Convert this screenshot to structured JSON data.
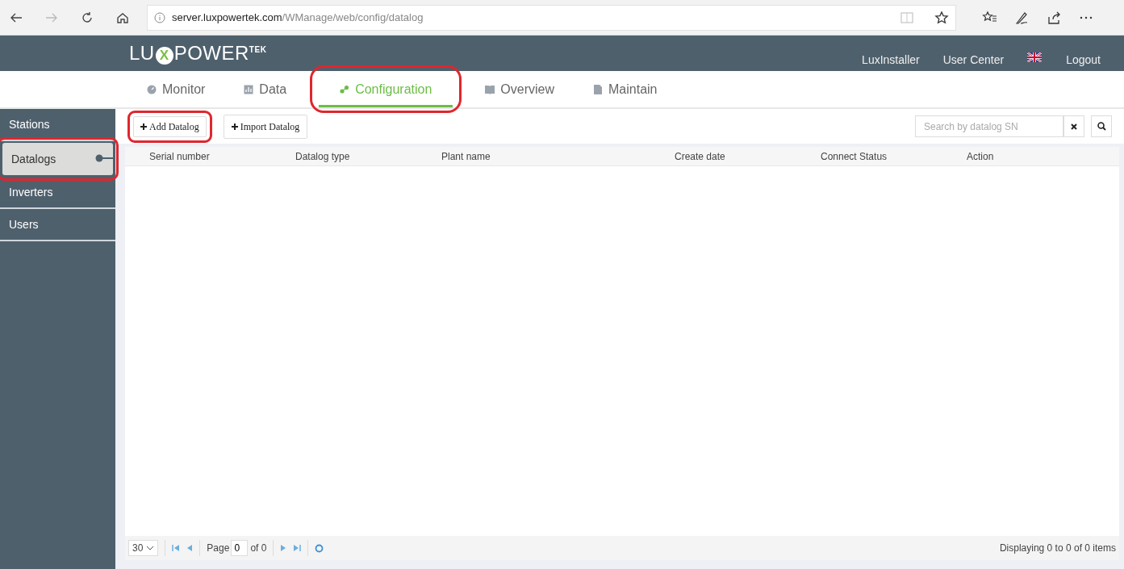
{
  "browser": {
    "url_host": "server.luxpowertek.com",
    "url_path": "/WManage/web/config/datalog"
  },
  "header": {
    "logo": {
      "left": "LU",
      "mark": "X",
      "right": "POWER",
      "sup": "TEK"
    },
    "links": [
      {
        "kind": "text",
        "label": "LuxInstaller"
      },
      {
        "kind": "text",
        "label": "User Center"
      },
      {
        "kind": "flag"
      },
      {
        "kind": "text",
        "label": "Logout"
      }
    ]
  },
  "tabs": [
    {
      "label": "Monitor",
      "selected": false,
      "highlighted": false
    },
    {
      "label": "Data",
      "selected": false,
      "highlighted": false
    },
    {
      "label": "Configuration",
      "selected": true,
      "highlighted": true
    },
    {
      "label": "Overview",
      "selected": false,
      "highlighted": false
    },
    {
      "label": "Maintain",
      "selected": false,
      "highlighted": false
    }
  ],
  "sidebar": {
    "items": [
      {
        "label": "Stations",
        "selected": false,
        "highlighted": false
      },
      {
        "label": "Datalogs",
        "selected": true,
        "highlighted": true
      },
      {
        "label": "Inverters",
        "selected": false,
        "highlighted": false
      },
      {
        "label": "Users",
        "selected": false,
        "highlighted": false
      }
    ]
  },
  "toolbar": {
    "buttons": [
      {
        "label": "Add Datalog",
        "highlighted": true
      },
      {
        "label": "Import Datalog",
        "highlighted": false
      }
    ],
    "search": {
      "placeholder": "Search by datalog SN"
    }
  },
  "table": {
    "columns": [
      "Serial number",
      "Datalog type",
      "Plant name",
      "Create date",
      "Connect Status",
      "Action"
    ]
  },
  "pager": {
    "page_size": "30",
    "page_label": "Page",
    "page_value": "0",
    "of_label": "of 0",
    "summary": "Displaying 0 to 0 of 0 items"
  }
}
